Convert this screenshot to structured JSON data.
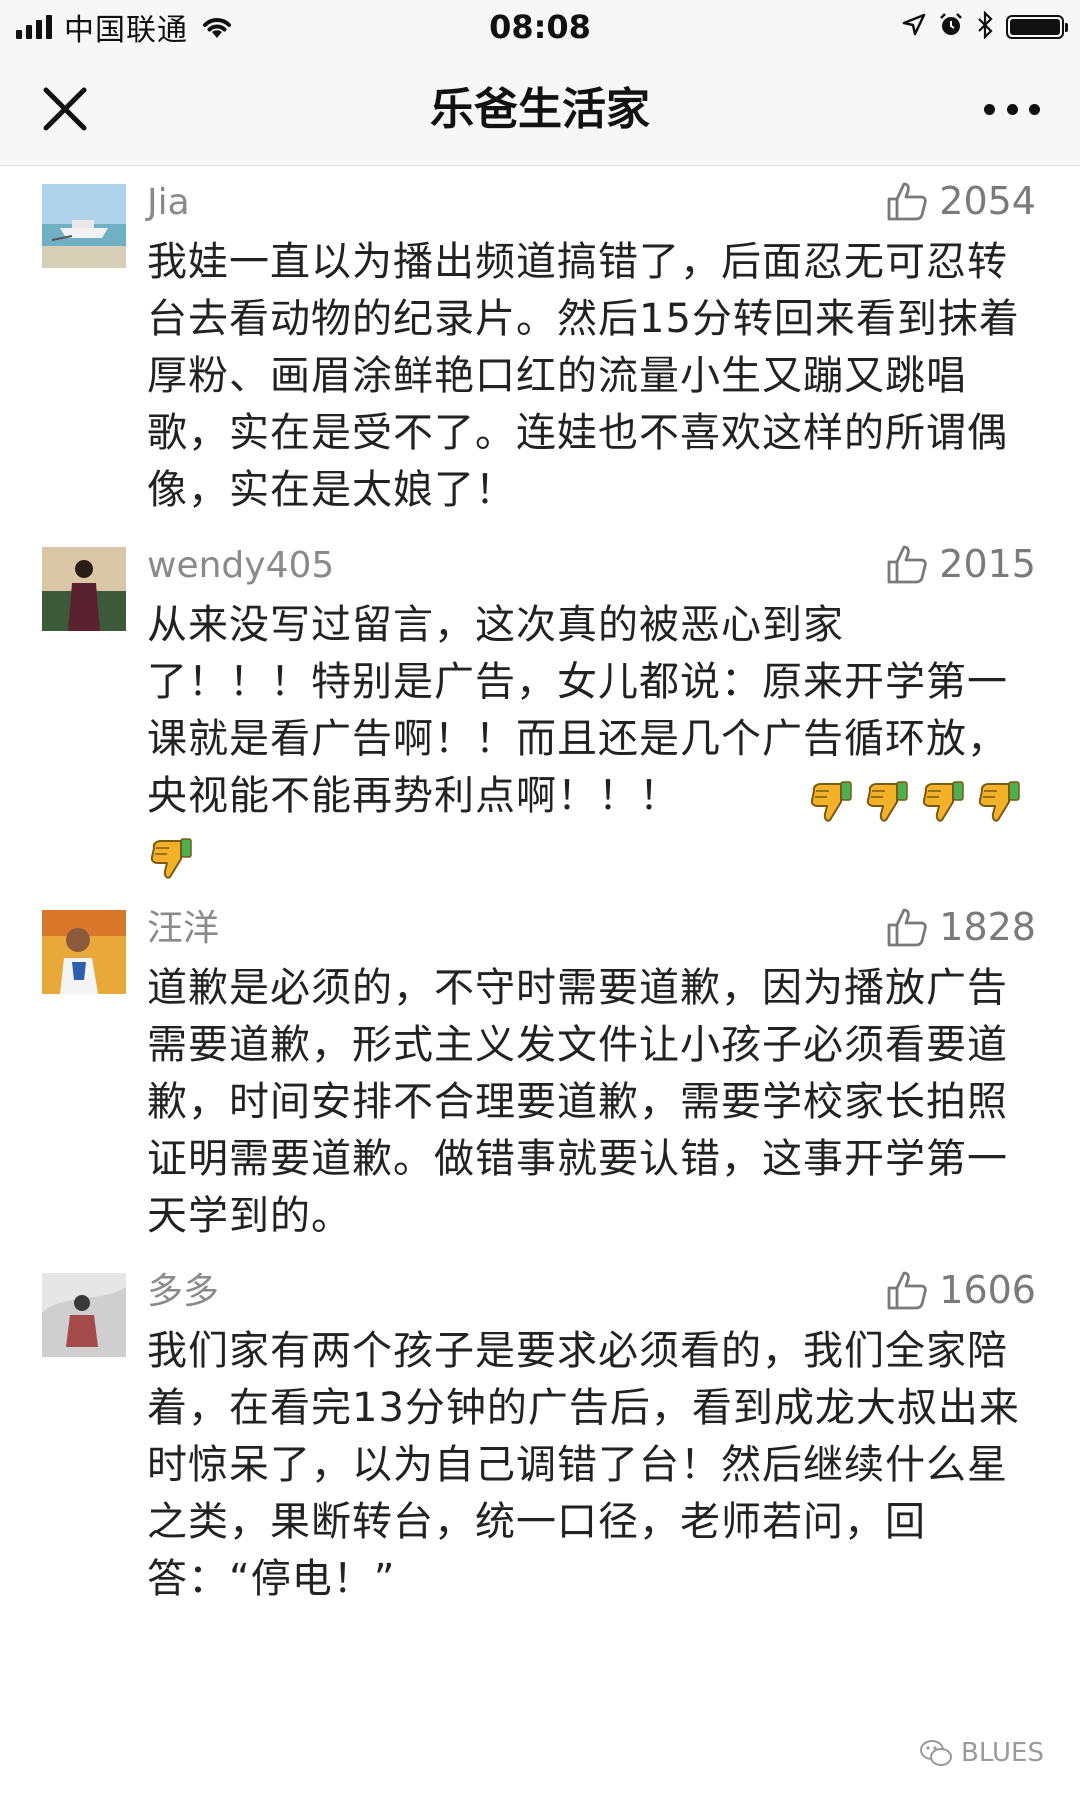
{
  "status_bar": {
    "carrier": "中国联通",
    "time": "08:08"
  },
  "nav": {
    "title": "乐爸生活家"
  },
  "comments": [
    {
      "username": "Jia",
      "likes": "2054",
      "text": "我娃一直以为播出频道搞错了，后面忍无可忍转台去看动物的纪录片。然后15分转回来看到抹着厚粉、画眉涂鲜艳口红的流量小生又蹦又跳唱歌，实在是受不了。连娃也不喜欢这样的所谓偶像，实在是太娘了！"
    },
    {
      "username": "wendy405",
      "likes": "2015",
      "text": "从来没写过留言，这次真的被恶心到家\n了！！！特别是广告，女儿都说：原来开学第一课就是看广告啊！！而且还是几个广告循环放，央视能不能再势利点啊！！！",
      "emoji_count": 5,
      "emoji_icon": "thumbs-down-emoji"
    },
    {
      "username": "汪洋",
      "likes": "1828",
      "text": "道歉是必须的，不守时需要道歉，因为播放广告需要道歉，形式主义发文件让小孩子必须看要道歉，时间安排不合理要道歉，需要学校家长拍照证明需要道歉。做错事就要认错，这事开学第一天学到的。"
    },
    {
      "username": "多多",
      "likes": "1606",
      "text": "我们家有两个孩子是要求必须看的，我们全家陪着，在看完13分钟的广告后，看到成龙大叔出来时惊呆了，以为自己调错了台！然后继续什么星之类，果断转台，统一口径，老师若问，回答：“停电！”"
    }
  ],
  "watermark": {
    "text": "BLUES"
  },
  "colors": {
    "text": "#222222",
    "meta": "#8a8a8a",
    "bar_bg": "#f7f7f7"
  }
}
